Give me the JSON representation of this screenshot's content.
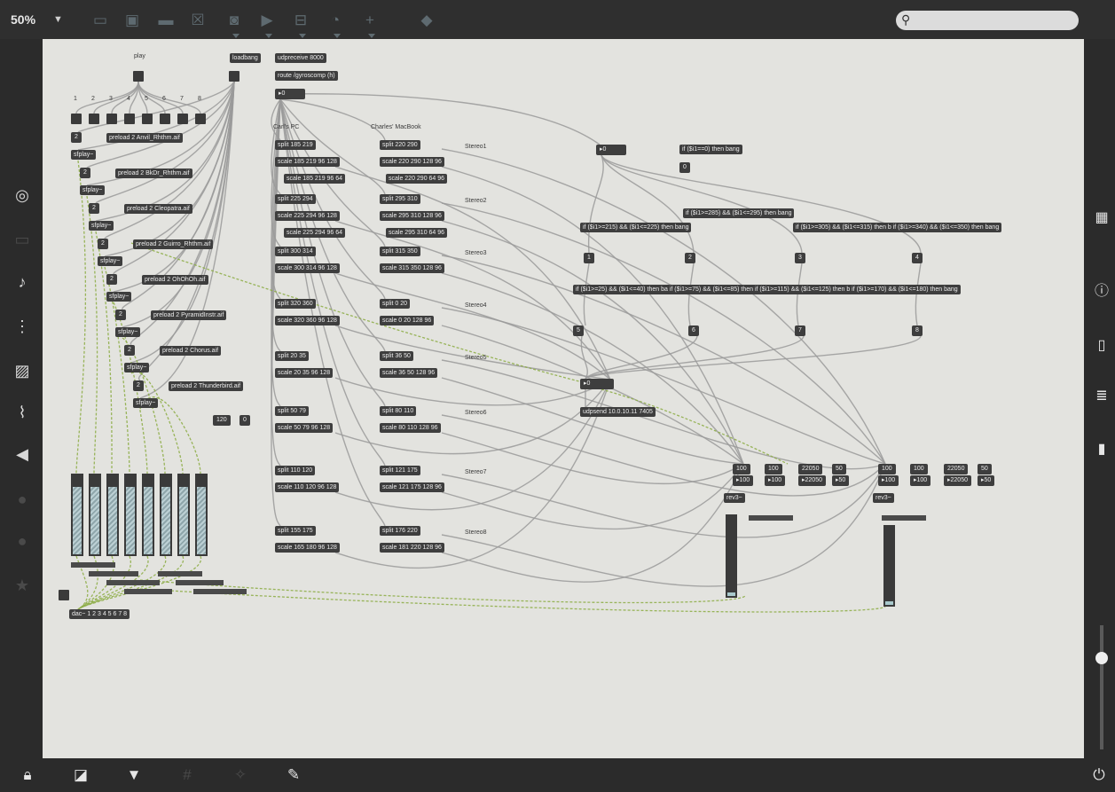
{
  "toolbar": {
    "zoom": "50%",
    "zoom_caret": "▼",
    "icons": [
      "presentation-icon",
      "message-icon",
      "comment-icon",
      "toggle-icon",
      "button-icon",
      "play-icon",
      "slider-icon",
      "dial-icon",
      "plus-icon",
      "paint-bucket-icon"
    ]
  },
  "search": {
    "placeholder": ""
  },
  "left_sidebar": {
    "icons": [
      "target-icon",
      "window-icon",
      "note-icon",
      "step-icon",
      "image-icon",
      "paperclip-icon",
      "plug-icon",
      "vimeo-icon",
      "bandcamp-icon",
      "star-icon"
    ]
  },
  "right_sidebar": {
    "icons": [
      "grid-icon",
      "info-icon",
      "book-icon",
      "list-icon",
      "open-book-icon"
    ]
  },
  "bottom_bar": {
    "icons": [
      "lock-icon",
      "windows-icon",
      "presentation-icon",
      "grid-icon",
      "wand-icon",
      "wrench-icon",
      "power-icon"
    ]
  },
  "patch": {
    "comments": {
      "play": "play",
      "carls_pc": "Carl's PC",
      "charles_macbook": "Charles' MacBook",
      "stereo": [
        "Stereo1",
        "Stereo2",
        "Stereo3",
        "Stereo4",
        "Stereo5",
        "Stereo6",
        "Stereo7",
        "Stereo8"
      ],
      "channel_numbers": [
        "1",
        "2",
        "3",
        "4",
        "5",
        "6",
        "7",
        "8"
      ]
    },
    "objects": {
      "loadbang": "loadbang",
      "udpreceive": "udpreceive 8000",
      "route": "route /gyroscomp (h)",
      "num_top": "▸0",
      "preload": [
        "preload 2 Anvil_Rhthm.aif",
        "preload 2 BkDr_Rhthm.aif",
        "preload 2 Cleopatra.aif",
        "preload 2 Guirro_Rhthm.aif",
        "preload 2 OhOhOh.aif",
        "preload 2 PyramidInstr.aif",
        "preload 2 Chorus.aif",
        "preload 2 Thunderbird.aif"
      ],
      "sfplay": "sfplay~",
      "two": "2",
      "carl_rows": [
        [
          "split 185 219",
          "scale 185 219 96 128",
          "scale 185 219 96 64"
        ],
        [
          "split 225 294",
          "scale 225 294 96 128",
          "scale 225 294 96 64"
        ],
        [
          "split 300 314",
          "scale 300 314 96 128"
        ],
        [
          "split 320 360",
          "scale 320 360 96 128"
        ],
        [
          "split 20 35",
          "scale 20 35 96 128"
        ],
        [
          "split 50 79",
          "scale 50 79 96 128"
        ],
        [
          "split 110 120",
          "scale 110 120 96 128"
        ],
        [
          "split 155 175",
          "scale 165 180 96 128"
        ]
      ],
      "mac_rows": [
        [
          "split 220 290",
          "scale 220 290 128 96",
          "scale 220 290 64 96"
        ],
        [
          "split 295 310",
          "scale 295 310 128 96",
          "scale 295 310 64 96"
        ],
        [
          "split 315 350",
          "scale 315 350 128 96"
        ],
        [
          "split 0 20",
          "scale 0 20 128 96"
        ],
        [
          "split 36 50",
          "scale 36 50 128 96"
        ],
        [
          "split 80 110",
          "scale 80 110 128 96"
        ],
        [
          "split 121 175",
          "scale 121 175 128 96"
        ],
        [
          "split 176 220",
          "scale 181 220 128 96"
        ]
      ],
      "num_120": "120",
      "num_0": "0",
      "num_mid": "▸0",
      "if_zero": "if ($i1==0) then bang",
      "zero_out": "0",
      "if_285": "if ($i1>=285) && ($i1<=295) then bang",
      "if_215": "if ($i1>=215) && ($i1<=225) then bang",
      "if_305_340": "if ($i1>=305) && ($i1<=315) then b if ($i1>=340) && ($i1<=350) then bang",
      "ifs_row2": "if ($i1>=25) && ($i1<=40) then ba if ($i1>=75) && ($i1<=85) then if ($i1>=115) && ($i1<=125) then b if ($i1>=170) && ($i1<=180) then bang",
      "row1_nums": [
        "1",
        "2",
        "3",
        "4"
      ],
      "row2_nums": [
        "5",
        "6",
        "7",
        "8"
      ],
      "num_center": "▸0",
      "udpsend": "udpsend 10.0.10.11 7405",
      "rev_values": [
        "100",
        "100",
        "22050",
        "50"
      ],
      "rev_nums": [
        "▸100",
        "▸100",
        "▸22050",
        "▸50"
      ],
      "rev3": "rev3~",
      "dac": "dac~ 1 2 3 4 5 6 7 8"
    }
  }
}
